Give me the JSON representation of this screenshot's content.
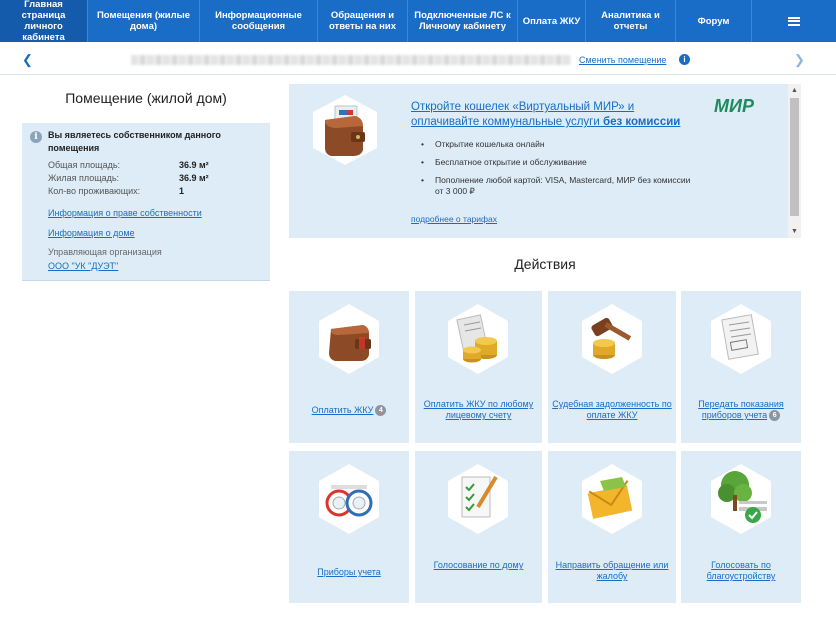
{
  "nav": {
    "items": [
      {
        "label": "Главная страница личного кабинета"
      },
      {
        "label": "Помещения (жилые дома)"
      },
      {
        "label": "Информационные сообщения"
      },
      {
        "label": "Обращения и ответы на них"
      },
      {
        "label": "Подключенные ЛС к Личному кабинету"
      },
      {
        "label": "Оплата ЖКУ"
      },
      {
        "label": "Аналитика и отчеты"
      },
      {
        "label": "Форум"
      }
    ],
    "menu_icon": "hamburger-icon"
  },
  "address_bar": {
    "change_link": "Сменить помещение",
    "info_icon": "i"
  },
  "premise": {
    "title": "Помещение (жилой дом)",
    "owner_text": "Вы являетесь собственником данного помещения",
    "total_area_label": "Общая площадь:",
    "total_area_value": "36.9 м²",
    "living_area_label": "Жилая площадь:",
    "living_area_value": "36.9 м²",
    "residents_label": "Кол-во проживающих:",
    "residents_value": "1",
    "ownership_link": "Информация о праве собственности",
    "house_link": "Информация о доме",
    "management_label": "Управляющая организация",
    "management_link": "ООО \"УК \"ДУЭТ\""
  },
  "promo": {
    "title_part1": "Откройте кошелек «Виртуальный МИР» и оплачивайте коммунальные услуги ",
    "title_bold": "без комиссии",
    "brand": "МИР",
    "bullets": [
      "Открытие кошелька онлайн",
      "Бесплатное открытие и обслуживание",
      "Пополнение любой картой: VISA, Mastercard, МИР без комиссии от 3 000 ₽"
    ],
    "more_link": "подробнее о тарифах",
    "brand_color": "#1f8a5b"
  },
  "actions": {
    "title": "Действия",
    "tiles": [
      {
        "label": "Оплатить ЖКУ",
        "badge": "4",
        "icon": "wallet-icon"
      },
      {
        "label": "Оплатить ЖКУ по любому лицевому счету",
        "badge": "",
        "icon": "coins-receipt-icon"
      },
      {
        "label": "Судебная задолженность по оплате ЖКУ",
        "badge": "",
        "icon": "gavel-coins-icon"
      },
      {
        "label": "Передать показания приборов учета",
        "badge": "6",
        "icon": "meter-receipt-icon"
      },
      {
        "label": "Приборы учета",
        "badge": "",
        "icon": "water-meters-icon"
      },
      {
        "label": "Голосование по дому",
        "badge": "",
        "icon": "checklist-pen-icon"
      },
      {
        "label": "Направить обращение или жалобу",
        "badge": "",
        "icon": "envelope-icon"
      },
      {
        "label": "Голосовать по благоустройству",
        "badge": "",
        "icon": "tree-bench-icon"
      }
    ]
  },
  "colors": {
    "nav_bg": "#1a6dc6",
    "panel_bg": "#ddecf7",
    "link": "#1a6dc6"
  }
}
